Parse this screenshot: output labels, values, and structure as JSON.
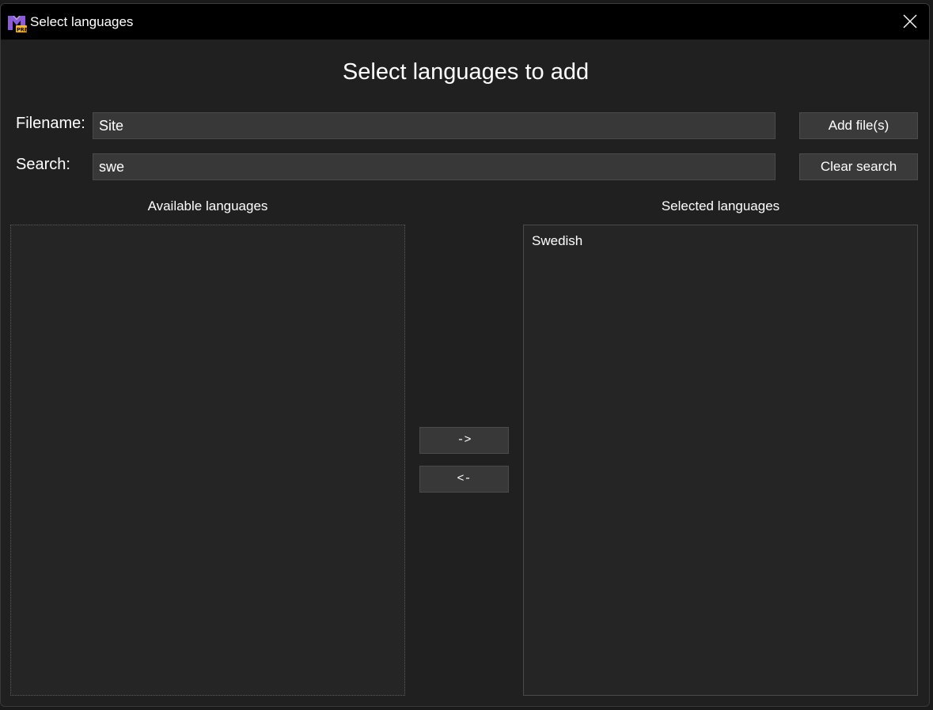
{
  "window": {
    "title": "Select languages",
    "app_icon": "visual-studio-preview-icon",
    "close_icon": "close-icon"
  },
  "dialog": {
    "heading": "Select languages to add",
    "filename": {
      "label": "Filename:",
      "value": "Site"
    },
    "search": {
      "label": "Search:",
      "value": "swe"
    },
    "add_files_label": "Add file(s)",
    "clear_search_label": "Clear search",
    "available": {
      "header": "Available languages",
      "items": []
    },
    "selected": {
      "header": "Selected languages",
      "items": [
        "Swedish"
      ]
    },
    "move_right_label": "->",
    "move_left_label": "<-"
  },
  "colors": {
    "titlebar": "#000000",
    "background": "#202020",
    "input": "#383838",
    "button": "#3a3a3a",
    "text": "#ffffff",
    "icon_purple": "#8b5cd6",
    "icon_badge": "#f0b73a"
  }
}
